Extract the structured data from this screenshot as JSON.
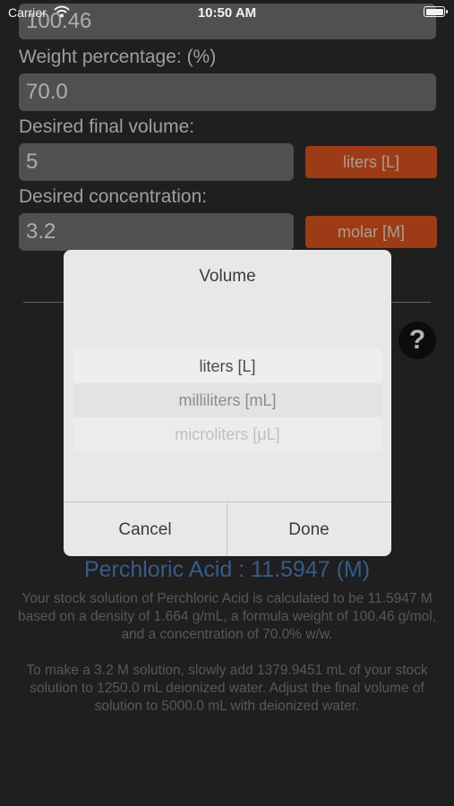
{
  "status_bar": {
    "carrier": "Carrier",
    "time": "10:50 AM"
  },
  "form": {
    "formula_weight_value": "100.46",
    "weight_percentage_label": "Weight percentage:  (%)",
    "weight_percentage_value": "70.0",
    "final_volume_label": "Desired final volume:",
    "final_volume_value": "5",
    "final_volume_unit": "liters [L]",
    "concentration_label": "Desired concentration:",
    "concentration_value": "3.2",
    "concentration_unit": "molar [M]"
  },
  "help": {
    "label": "?"
  },
  "result": {
    "title": "Perchloric Acid : 11.5947 (M)",
    "paragraph1": "Your stock solution of Perchloric Acid is calculated to be 11.5947 M based on a density of 1.664 g/mL, a formula weight of 100.46 g/mol, and a concentration of 70.0% w/w.",
    "paragraph2": "To make a 3.2 M solution, slowly add 1379.9451 mL of your stock solution to 1250.0 mL deionized water. Adjust the final volume of solution to 5000.0 mL with deionized water."
  },
  "picker_dialog": {
    "title": "Volume",
    "options": [
      "liters [L]",
      "milliliters [mL]",
      "microliters [μL]"
    ],
    "selected": "liters [L]",
    "cancel_label": "Cancel",
    "done_label": "Done"
  }
}
